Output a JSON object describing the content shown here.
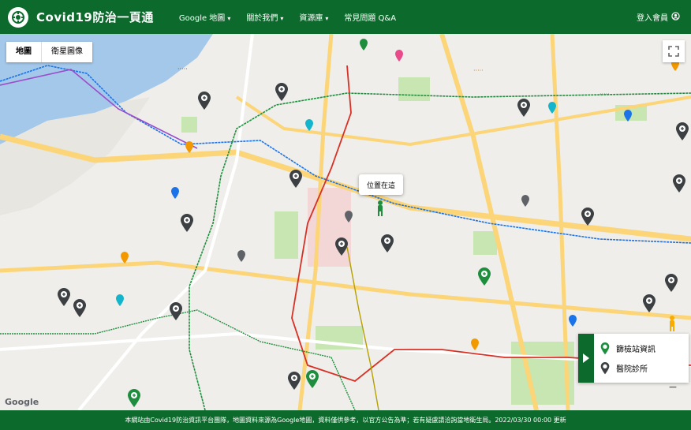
{
  "header": {
    "title": "Covid19防治一頁通",
    "nav": [
      {
        "label": "Google 地圖"
      },
      {
        "label": "關於我們"
      },
      {
        "label": "資源庫"
      },
      {
        "label": "常見問題 Q&A"
      }
    ],
    "login_label": "登入會員"
  },
  "map": {
    "type_map": "地圖",
    "type_satellite": "衛星圖像",
    "popup_label": "位置在這",
    "google_label": "Google"
  },
  "legend": {
    "item1": "篩檢站資訊",
    "item2": "醫院診所"
  },
  "footer": {
    "text": "本網站由Covid19防治資訊平台團隊，地圖資料來源為Google地圖，資料僅供參考，以官方公告為準；若有疑慮請洽詢當地衛生局。2022/03/30 00:00 更新"
  },
  "colors": {
    "brand": "#0c6b2c",
    "river": "#a4c8ea",
    "road": "#fbd578",
    "park": "#c7e6b1"
  },
  "icons": {
    "logo": "virus-logo-icon",
    "user": "user-icon",
    "fullscreen": "fullscreen-icon",
    "pin": "map-pin-icon"
  }
}
